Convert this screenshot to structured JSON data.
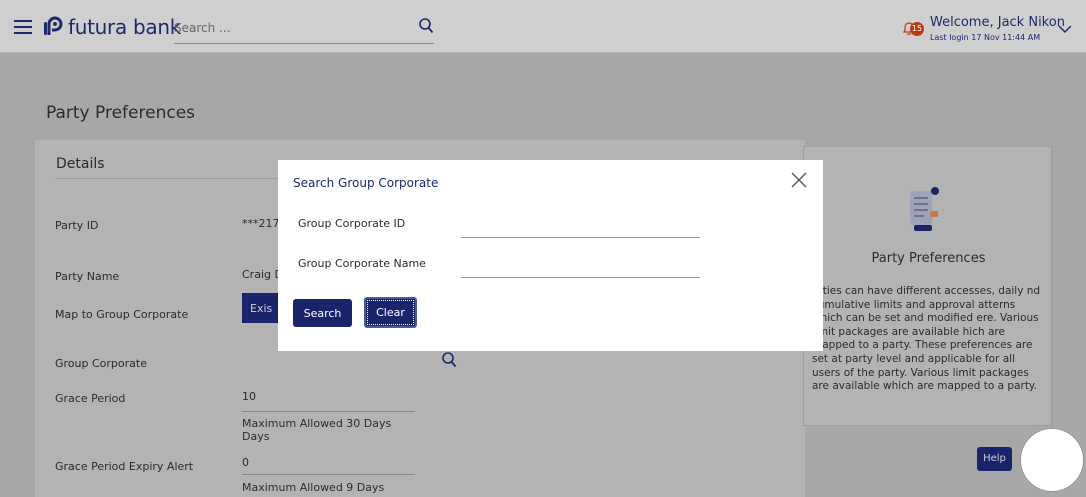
{
  "header": {
    "brand": "futura bank",
    "search_placeholder": "Search ...",
    "notification_count": "15",
    "welcome": "Welcome, Jack Nikon",
    "last_login": "Last login 17 Nov 11:44 AM",
    "icons": [
      "hamburger-menu-icon",
      "futura-logo-icon",
      "search-icon",
      "bell-icon",
      "chevron-down-icon"
    ]
  },
  "page": {
    "title": "Party Preferences",
    "details_title": "Details",
    "rows": [
      {
        "label": "Party ID",
        "value": "***217"
      },
      {
        "label": "Party Name",
        "value": "Craig D"
      },
      {
        "label": "Map to Group Corporate",
        "value": "Exis"
      },
      {
        "label": "Group Corporate",
        "value": ""
      },
      {
        "label": "Grace Period",
        "value": "10",
        "hint": "Maximum Allowed 30 Days Days"
      },
      {
        "label": "Grace Period Expiry Alert",
        "value": "0",
        "hint": "Maximum Allowed 9 Days"
      }
    ]
  },
  "info_panel": {
    "title": "Party Preferences",
    "text": "arties can have different accesses, daily nd cumulative limits and approval atterns which can be set and modified ere. Various limit packages are available hich are mapped to a party. These preferences are set at party level and applicable for all users of the party. Various limit packages are available which are mapped to a party."
  },
  "help": {
    "label": "Help"
  },
  "modal": {
    "title": "Search Group Corporate",
    "fields": [
      {
        "label": "Group Corporate ID",
        "value": ""
      },
      {
        "label": "Group Corporate Name",
        "value": ""
      }
    ],
    "search_label": "Search",
    "clear_label": "Clear"
  },
  "colors": {
    "primary": "#1a246b",
    "badge": "#b93b13",
    "overlay": "#a7a7a7"
  }
}
